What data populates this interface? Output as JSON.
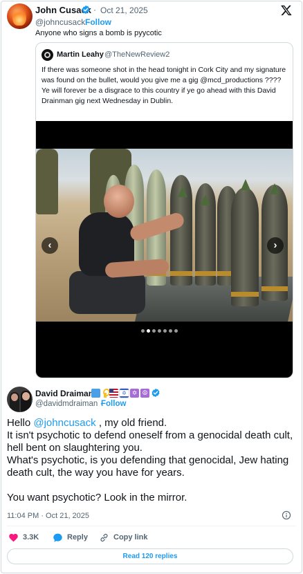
{
  "tweet": {
    "author": {
      "name": "John Cusack",
      "handle": "@johncusack",
      "follow_label": "Follow",
      "verified": true
    },
    "separator": "·",
    "date": "Oct 21, 2025",
    "text": "Anyone who signs a bomb is pyycotic"
  },
  "quoted_tweet": {
    "author": {
      "name": "Martin Leahy",
      "handle": "@TheNewReview2"
    },
    "paragraphs": [
      "If there was someone shot in the head tonight in Cork City and my signature was found on the bullet, would you give me a gig @mcd_productions ????",
      "Ye will forever be a disgrace to this country if ye go ahead with this David Drainman gig next Wednesday in Dublin."
    ],
    "media": {
      "carousel_prev": "‹",
      "carousel_next": "›",
      "carousel_pages": 7,
      "carousel_current_index": 1
    }
  },
  "reply": {
    "author": {
      "name": "David Draiman",
      "handle": "@davidmdraiman",
      "follow_label": "Follow",
      "verified": true,
      "name_emojis": [
        "blue-square",
        "yellow-ribbon",
        "us-flag",
        "israel-flag",
        "star-of-david",
        "peace-symbol"
      ]
    },
    "separator": "·",
    "greeting": "Hello",
    "mention": "@johncusack",
    "greeting_rest": ", my old friend.",
    "paragraph_2": "It isn't psychotic to defend oneself from a genocidal death cult, hell bent on slaughtering you.",
    "paragraph_3": "What's psychotic, is you defending that genocidal, Jew hating death cult, the way you have for years.",
    "paragraph_4": "You want psychotic? Look in the mirror.",
    "timestamp": "11:04 PM · Oct 21, 2025",
    "actions": {
      "likes": "3.3K",
      "reply_label": "Reply",
      "copy_label": "Copy link"
    },
    "read_replies_label": "Read 120 replies"
  },
  "colors": {
    "accent": "#1d9bf0",
    "secondary_text": "#536471",
    "like": "#f91880",
    "border": "#cfd9de"
  },
  "icons": {
    "platform_logo": "x-logo-icon",
    "verified": "verified-badge-icon",
    "info": "info-icon",
    "like": "heart-icon",
    "reply": "reply-bubble-icon",
    "copy_link": "link-icon"
  }
}
